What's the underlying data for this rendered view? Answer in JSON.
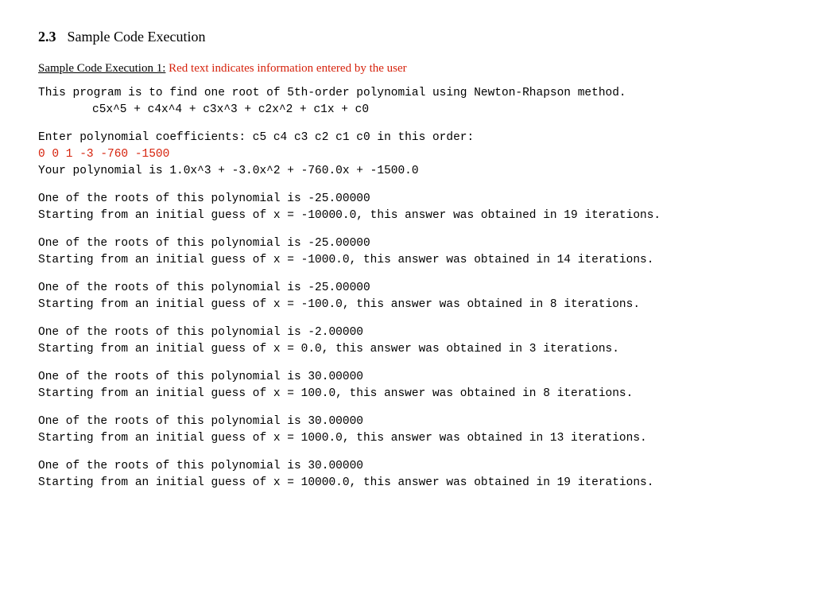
{
  "section": {
    "number": "2.3",
    "title": "Sample Code Execution"
  },
  "subheading": {
    "label": "Sample Code Execution 1:",
    "red_note": "Red text indicates information entered by the user"
  },
  "intro": {
    "line1": "This program is to find one root of 5th-order polynomial using Newton-Rhapson method.",
    "poly": "c5x^5 + c4x^4 + c3x^3 + c2x^2 + c1x + c0"
  },
  "prompt": "Enter polynomial coefficients: c5 c4 c3 c2 c1 c0 in this order:",
  "user_input": "0 0 1 -3 -760 -1500",
  "echo": "Your polynomial is 1.0x^3 + -3.0x^2 + -760.0x + -1500.0",
  "runs": [
    {
      "root": "-25.00000",
      "guess": "-10000.0",
      "iters": "19"
    },
    {
      "root": "-25.00000",
      "guess": "-1000.0",
      "iters": "14"
    },
    {
      "root": "-25.00000",
      "guess": "-100.0",
      "iters": "8"
    },
    {
      "root": "-2.00000",
      "guess": "0.0",
      "iters": "3"
    },
    {
      "root": "30.00000",
      "guess": "100.0",
      "iters": "8"
    },
    {
      "root": "30.00000",
      "guess": "1000.0",
      "iters": "13"
    },
    {
      "root": "30.00000",
      "guess": "10000.0",
      "iters": "19"
    }
  ],
  "tpl": {
    "root_prefix": "One of the roots of this polynomial is ",
    "guess_prefix": "Starting from an initial guess of x = ",
    "guess_mid": ", this answer was obtained in ",
    "guess_suffix": " iterations."
  }
}
